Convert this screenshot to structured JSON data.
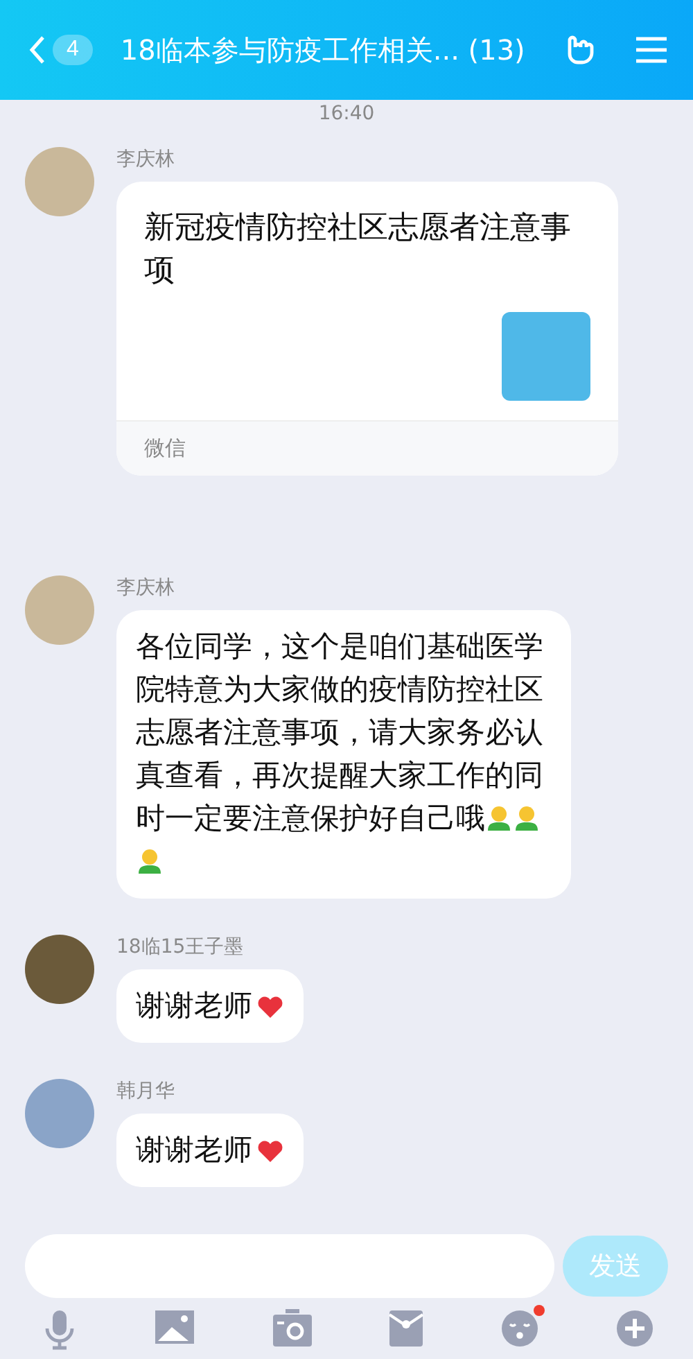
{
  "header": {
    "unread": "4",
    "title": "18临本参与防疫工作相关... (13)"
  },
  "time": "16:40",
  "messages": [
    {
      "kind": "card",
      "sender": "李庆林",
      "title": "新冠疫情防控社区志愿者注意事项",
      "source": "微信"
    },
    {
      "kind": "text",
      "sender": "李庆林",
      "text": "各位同学，这个是咱们基础医学院特意为大家做的疫情防控社区志愿者注意事项，请大家务必认真查看，再次提醒大家工作的同时一定要注意保护好自己哦",
      "emojis": [
        {
          "kind": "person"
        },
        {
          "kind": "person"
        },
        {
          "kind": "person"
        }
      ]
    },
    {
      "kind": "text",
      "sender": "18临15王子墨",
      "text": "谢谢老师",
      "emojis": [
        {
          "kind": "heart"
        }
      ]
    },
    {
      "kind": "text",
      "sender": "韩月华",
      "text": "谢谢老师",
      "emojis": [
        {
          "kind": "heart"
        }
      ]
    }
  ],
  "input": {
    "send": "发送"
  },
  "toolbar": {
    "emoji_badge": true
  }
}
